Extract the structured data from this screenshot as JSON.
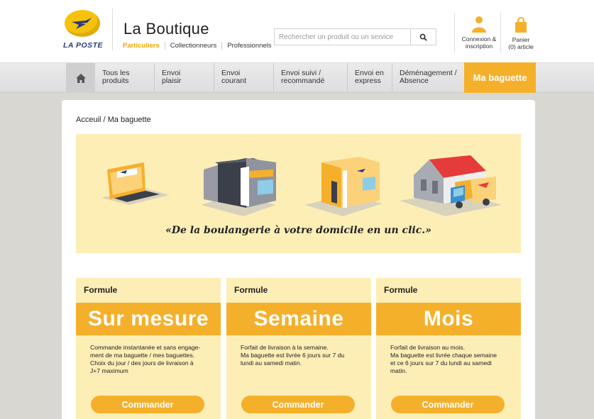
{
  "header": {
    "logo_text": "LA POSTE",
    "brand_title": "La Boutique",
    "subnav": [
      "Particuliers",
      "Collectionneurs",
      "Professionnels"
    ],
    "search_placeholder": "Rechercher un produit ou un service",
    "account_line1": "Connexion &",
    "account_line2": "inscription",
    "cart_line1": "Panier",
    "cart_line2": "(0) article"
  },
  "nav": {
    "items": [
      {
        "line1": "Tous les",
        "line2": "produits"
      },
      {
        "line1": "Envoi",
        "line2": "plaisir"
      },
      {
        "line1": "Envoi",
        "line2": "courant"
      },
      {
        "line1": "Envoi suivi /",
        "line2": "recommandé"
      },
      {
        "line1": "Envoi en",
        "line2": "express"
      },
      {
        "line1": "Déménagement /",
        "line2": "Absence"
      }
    ],
    "cta": "Ma baguette"
  },
  "breadcrumb": "Acceuil / Ma baguette",
  "banner": {
    "tagline": "«De la boulangerie à votre domicile en un clic.»"
  },
  "cards": [
    {
      "kicker": "Formule",
      "title": "Sur mesure",
      "desc_lines": [
        "Commande instantanée et sans engage-",
        "ment de ma baguette / mes baguettes.",
        "Choix du jour / des jours de livraison à",
        "J+7 maximum"
      ],
      "button": "Commander"
    },
    {
      "kicker": "Formule",
      "title": "Semaine",
      "desc_lines": [
        "Forfait de livraison à la semaine.",
        "Ma baguette est livrée 6 jours sur 7 du",
        "lundi au samedi matin."
      ],
      "button": "Commander"
    },
    {
      "kicker": "Formule",
      "title": "Mois",
      "desc_lines": [
        "Forfait de livraison au mois.",
        "Ma baguette est livrée chaque semaine",
        "et ce 6 jours sur 7 du lundi au samedi",
        "matin."
      ],
      "button": "Commander"
    }
  ],
  "colors": {
    "accent": "#f5b02b",
    "banner_bg": "#fdeeb6",
    "logo_yellow": "#f6c20e",
    "logo_blue": "#2a3a7a"
  }
}
